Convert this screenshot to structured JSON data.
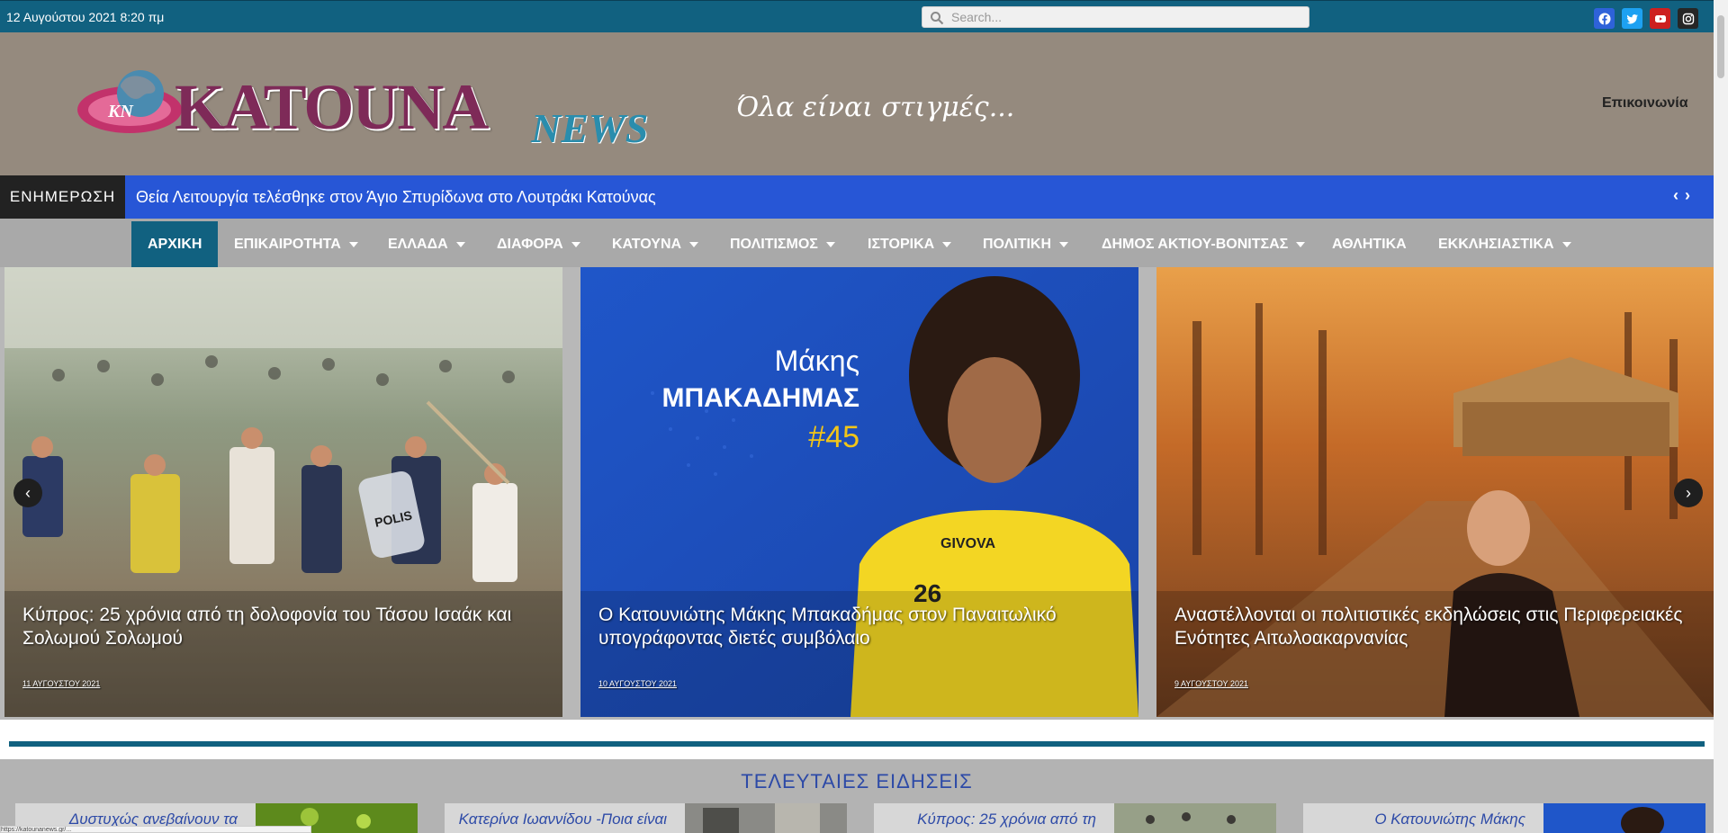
{
  "topbar": {
    "date": "12 Αυγούστου 2021 8:20 πμ",
    "search_placeholder": "Search...",
    "social": [
      {
        "name": "facebook-icon",
        "color": "#2e62d9"
      },
      {
        "name": "twitter-icon",
        "color": "#1da1f2"
      },
      {
        "name": "youtube-icon",
        "color": "#cd201f"
      },
      {
        "name": "instagram-icon",
        "color": "#262626"
      }
    ]
  },
  "header": {
    "logo_main": "KATOUNA",
    "logo_sub": "NEWS",
    "logo_badge": "KN",
    "slogan": "Όλα είναι στιγμές...",
    "contact_label": "Επικοινωνία"
  },
  "ticker": {
    "label": "ΕΝΗΜΕΡΩΣΗ",
    "headline": "Θεία Λειτουργία τελέσθηκε στον Άγιο Σπυρίδωνα στο Λουτράκι Κατούνας"
  },
  "nav": {
    "items": [
      {
        "label": "ΑΡΧΙΚΗ"
      },
      {
        "label": "ΕΠΙΚΑΙΡΟΤΗΤΑ"
      },
      {
        "label": "ΕΛΛΑΔΑ"
      },
      {
        "label": "ΔΙΑΦΟΡΑ"
      },
      {
        "label": "ΚΑΤΟΥΝΑ"
      },
      {
        "label": "ΠΟΛΙΤΙΣΜΟΣ"
      },
      {
        "label": "ΙΣΤΟΡΙΚΑ"
      },
      {
        "label": "ΠΟΛΙΤΙΚΗ"
      },
      {
        "label": "ΔΗΜΟΣ ΑΚΤΙΟΥ-ΒΟΝΙΤΣΑΣ"
      },
      {
        "label": "ΑΘΛΗΤΙΚΑ"
      },
      {
        "label": "ΕΚΚΛΗΣΙΑΣΤΙΚΑ"
      }
    ]
  },
  "slides": [
    {
      "title": "Κύπρος: 25 χρόνια από τη δολοφονία του Τάσου Ισαάκ και Σολωμού Σολωμού",
      "date": "11 ΑΥΓΟΥΣΤΟΥ 2021",
      "image_text": "POLIS"
    },
    {
      "title": "Ο Κατουνιώτης Μάκης Μπακαδήμας στον Παναιτωλικό υπογράφοντας διετές συμβόλαιο",
      "date": "10 ΑΥΓΟΥΣΤΟΥ 2021",
      "image_name": "Μάκης",
      "image_surname": "ΜΠΑΚΑΔΗΜΑΣ",
      "image_number": "#45",
      "image_brand": "GIVOVA",
      "image_shirt": "26"
    },
    {
      "title": "Αναστέλλονται οι πολιτιστικές εκδηλώσεις στις Περιφερειακές Ενότητες Αιτωλοακαρνανίας",
      "date": "9 ΑΥΓΟΥΣΤΟΥ 2021"
    }
  ],
  "latest": {
    "title": "ΤΕΛΕΥΤΑΙΕΣ ΕΙΔΗΣΕΙΣ",
    "cards": [
      {
        "title": "Δυστυχώς ανεβαίνουν τα"
      },
      {
        "title": "Κατερίνα Ιωαννίδου -Ποια είναι"
      },
      {
        "title": "Κύπρος: 25 χρόνια από τη"
      },
      {
        "title": "Ο Κατουνιώτης Μάκης"
      }
    ]
  },
  "status_text": "https://katounanews.gr/..."
}
